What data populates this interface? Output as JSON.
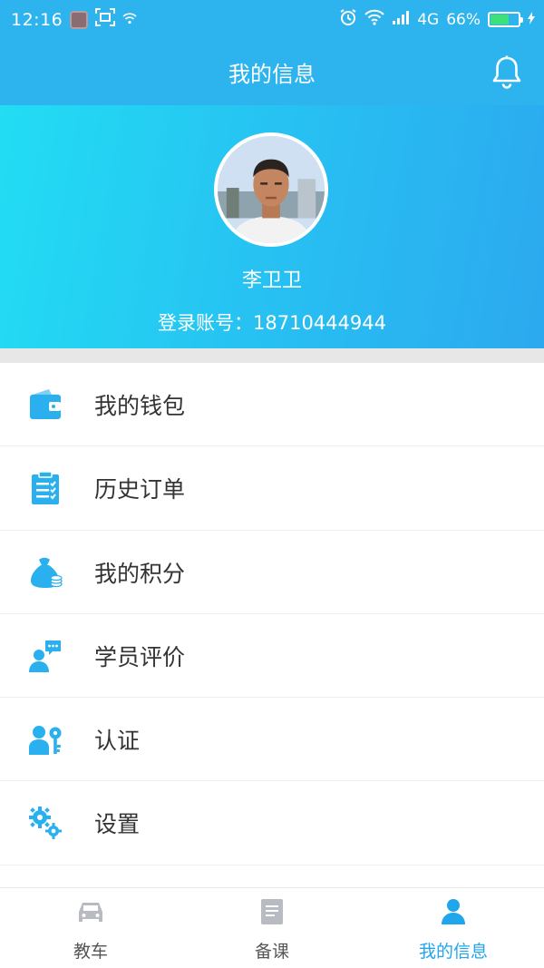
{
  "status_bar": {
    "time": "12:16",
    "network": "4G",
    "battery": "66%",
    "battery_level": 0.66
  },
  "header": {
    "title": "我的信息",
    "bell_icon": "bell-icon"
  },
  "profile": {
    "name": "李卫卫",
    "account_label": "登录账号：",
    "account": "18710444944",
    "account_text": "登录账号：18710444944"
  },
  "menu": {
    "items": [
      {
        "label": "我的钱包",
        "icon": "wallet-icon"
      },
      {
        "label": "历史订单",
        "icon": "clipboard-list-icon"
      },
      {
        "label": "我的积分",
        "icon": "money-bag-icon"
      },
      {
        "label": "学员评价",
        "icon": "user-comment-icon"
      },
      {
        "label": "认证",
        "icon": "user-key-icon"
      },
      {
        "label": "设置",
        "icon": "gears-icon"
      }
    ]
  },
  "tabs": [
    {
      "label": "教车",
      "icon": "car-icon",
      "active": false
    },
    {
      "label": "备课",
      "icon": "document-icon",
      "active": false
    },
    {
      "label": "我的信息",
      "icon": "user-icon",
      "active": true
    }
  ],
  "colors": {
    "header": "#2db3ee",
    "accent": "#1fa6ec",
    "icon_blue": "#2ab0ef",
    "inactive_tab": "#b8bcc2"
  }
}
